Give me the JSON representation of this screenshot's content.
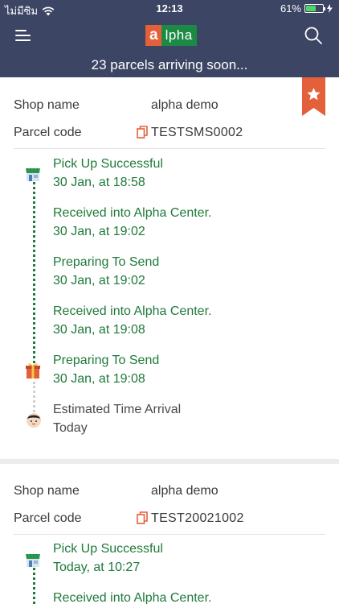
{
  "status_bar": {
    "carrier": "ไม่มีซิม",
    "time": "12:13",
    "battery": "61%",
    "battery_level": 0.61,
    "icons": [
      "wifi-icon",
      "battery-icon",
      "charging-bolt-icon"
    ]
  },
  "navbar": {
    "logo_a": "a",
    "logo_rest": "lpha",
    "icons": [
      "hamburger-menu-icon",
      "search-icon"
    ]
  },
  "banner": {
    "text": "23 parcels arriving soon..."
  },
  "labels": {
    "shop_name": "Shop name",
    "parcel_code": "Parcel code"
  },
  "parcels": [
    {
      "shop": "alpha demo",
      "code": "TESTSMS0002",
      "starred": true,
      "events": [
        {
          "status": "Pick Up Successful",
          "time": "30 Jan, at 18:58"
        },
        {
          "status": "Received into Alpha Center.",
          "time": "30 Jan, at 19:02"
        },
        {
          "status": "Preparing To Send",
          "time": "30 Jan, at 19:02"
        },
        {
          "status": "Received into Alpha Center.",
          "time": "30 Jan, at 19:08"
        },
        {
          "status": "Preparing To Send",
          "time": "30 Jan, at 19:08"
        }
      ],
      "eta": {
        "label": "Estimated Time Arrival",
        "value": "Today"
      }
    },
    {
      "shop": "alpha demo",
      "code": "TEST20021002",
      "starred": false,
      "events": [
        {
          "status": "Pick Up Successful",
          "time": "Today, at 10:27"
        },
        {
          "status": "Received into Alpha Center.",
          "time": ""
        }
      ]
    }
  ],
  "colors": {
    "header_bg": "#3c4563",
    "event_green": "#1e7a3a",
    "brand_orange": "#e4603a",
    "brand_green": "#1c8a45",
    "bookmark_orange": "#e4603a"
  }
}
